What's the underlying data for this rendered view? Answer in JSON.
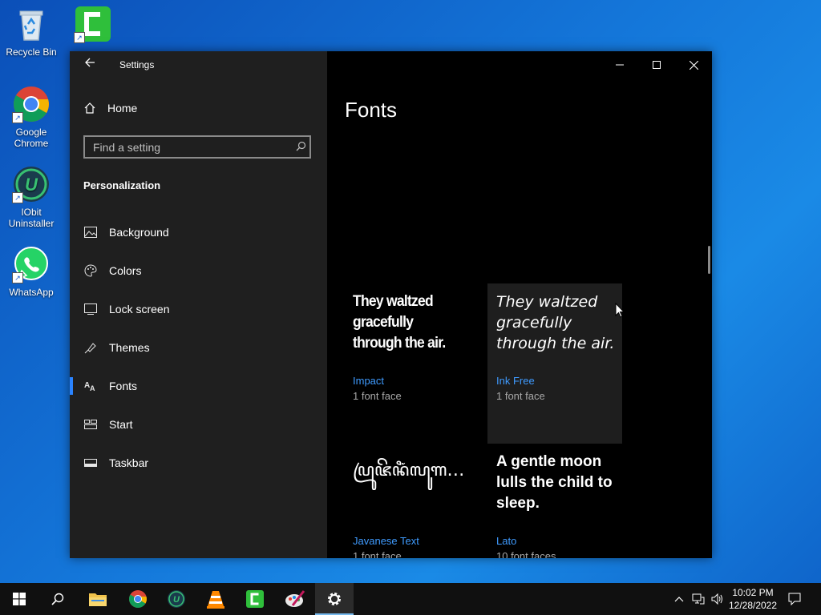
{
  "desktop": {
    "icons": [
      {
        "label": "Recycle Bin",
        "icon": "recycle-bin-icon"
      },
      {
        "label": "Camtasia",
        "icon": "camtasia-icon"
      },
      {
        "label": "Google Chrome",
        "icon": "chrome-icon"
      },
      {
        "label": "IObit Uninstaller",
        "icon": "iobit-uninstaller-icon"
      },
      {
        "label": "WhatsApp",
        "icon": "whatsapp-icon"
      }
    ]
  },
  "window": {
    "title": "Settings",
    "back_icon": "back-arrow-icon"
  },
  "nav": {
    "home_label": "Home",
    "search_placeholder": "Find a setting",
    "section_label": "Personalization",
    "items": [
      {
        "label": "Background",
        "icon": "picture-icon"
      },
      {
        "label": "Colors",
        "icon": "palette-icon"
      },
      {
        "label": "Lock screen",
        "icon": "lock-screen-icon"
      },
      {
        "label": "Themes",
        "icon": "themes-icon"
      },
      {
        "label": "Fonts",
        "icon": "fonts-icon",
        "active": true
      },
      {
        "label": "Start",
        "icon": "start-icon"
      },
      {
        "label": "Taskbar",
        "icon": "taskbar-icon"
      }
    ]
  },
  "content": {
    "page_title": "Fonts",
    "fonts": [
      {
        "sample": "They waltzed gracefully through the air.",
        "name": "Impact",
        "faces": "1 font face"
      },
      {
        "sample": "They waltzed gracefully through the air.",
        "name": "Ink Free",
        "faces": "1 font face"
      },
      {
        "sample": "ꦥꦿꦸꦗꦼꦤꦶꦁꦭꦸꦒ…",
        "name": "Javanese Text",
        "faces": "1 font face"
      },
      {
        "sample": "A gentle moon lulls the child to sleep.",
        "name": "Lato",
        "faces": "10 font faces"
      }
    ]
  },
  "taskbar": {
    "apps": [
      "start-icon",
      "search-icon",
      "file-explorer-icon",
      "chrome-icon",
      "iobit-uninstaller-icon",
      "vlc-icon",
      "camtasia-icon",
      "paint-icon",
      "settings-gear-icon"
    ],
    "time": "10:02 PM",
    "date": "12/28/2022"
  },
  "colors": {
    "accent": "#2a83ff",
    "link": "#3f9bff",
    "nav_bg": "#1f1f1f",
    "content_bg": "#000000"
  }
}
